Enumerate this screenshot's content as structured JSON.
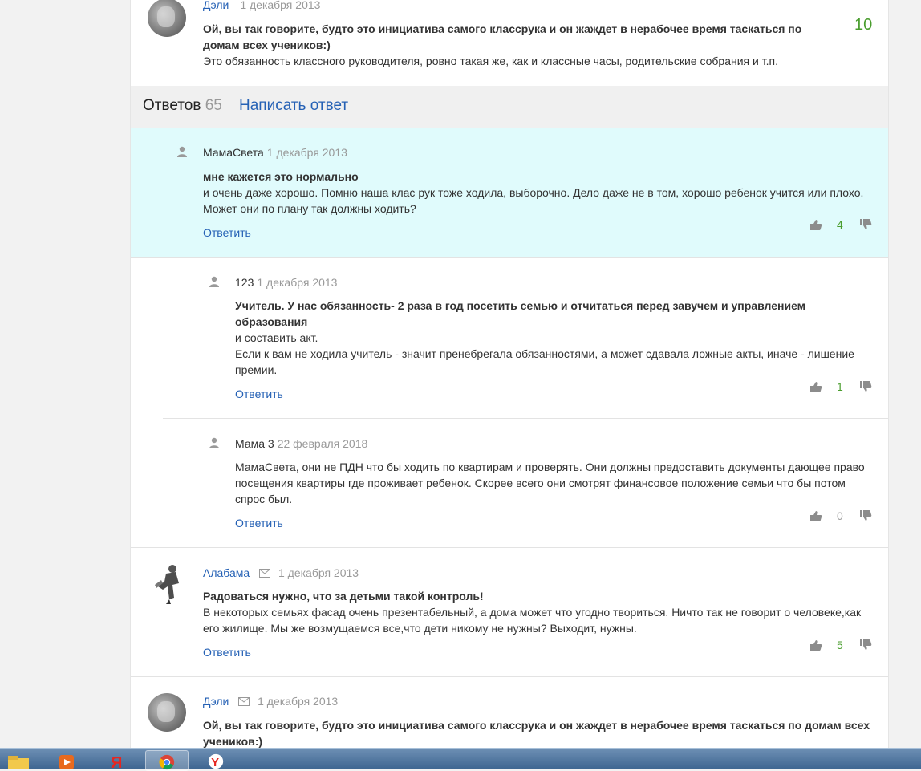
{
  "top_comment": {
    "author": "Дэли",
    "date": "1 декабря 2013",
    "bold_text": "Ой, вы так говорите, будто это инициатива самого классрука и он жаждет в нерабочее время таскаться по домам всех учеников:)",
    "text": "Это обязанность классного руководителя, ровно такая же, как и классные часы, родительские собрания и т.п.",
    "rating": "10"
  },
  "answers_header": {
    "label": "Ответов",
    "count": "65",
    "write_label": "Написать ответ"
  },
  "reply_label": "Ответить",
  "answers": [
    {
      "author": "МамаСвета",
      "date": "1 декабря 2013",
      "bold_text": "мне кажется это нормально",
      "lines": [
        "и очень даже хорошо. Помню наша клас рук тоже ходила, выборочно. Дело даже не в том, хорошо ребенок учится или плохо.",
        "Может они по плану так должны ходить?"
      ],
      "votes": "4"
    },
    {
      "author": "123",
      "date": "1 декабря 2013",
      "bold_lines": [
        "Учитель. У нас обязанность- 2 раза в год посетить семью и отчитаться перед завучем и управлением",
        "образования"
      ],
      "lines": [
        "и составить акт.",
        "Если к вам не ходила учитель - значит пренебрегала обязанностями, а может сдавала ложные акты, иначе - лишение",
        "премии."
      ],
      "votes": "1"
    },
    {
      "author": "Мама 3",
      "date": "22 февраля 2018",
      "lines": [
        "МамаСвета, они не ПДН что бы ходить по квартирам и проверять. Они должны предоставить документы дающее право",
        "посещения квартиры где проживает ребенок. Скорее всего они смотрят финансовое положение семьи что бы потом",
        "спрос был."
      ],
      "votes": "0"
    },
    {
      "author": "Алабама",
      "date": "1 декабря 2013",
      "bold_text": "Радоваться нужно, что за детьми такой контроль!",
      "lines": [
        "В некоторых семьях фасад очень презентабельный, а дома может что угодно твориться. Ничто так не говорит о человеке,как",
        "его жилище. Мы же возмущаемся все,что дети никому не нужны? Выходит, нужны."
      ],
      "votes": "5"
    },
    {
      "author": "Дэли",
      "date": "1 декабря 2013",
      "bold_lines": [
        "Ой, вы так говорите, будто это инициатива самого классрука и он жаждет в нерабочее время таскаться по домам всех",
        "учеников:)"
      ]
    }
  ],
  "colors": {
    "link": "#2561b5",
    "highlight_bg": "#e0fbfc",
    "votes_positive": "#4a9d2e",
    "votes_zero": "#999999"
  },
  "taskbar": {
    "icons": [
      "explorer-icon",
      "media-player-icon",
      "yandex-icon",
      "chrome-icon",
      "yandex-browser-icon"
    ]
  }
}
